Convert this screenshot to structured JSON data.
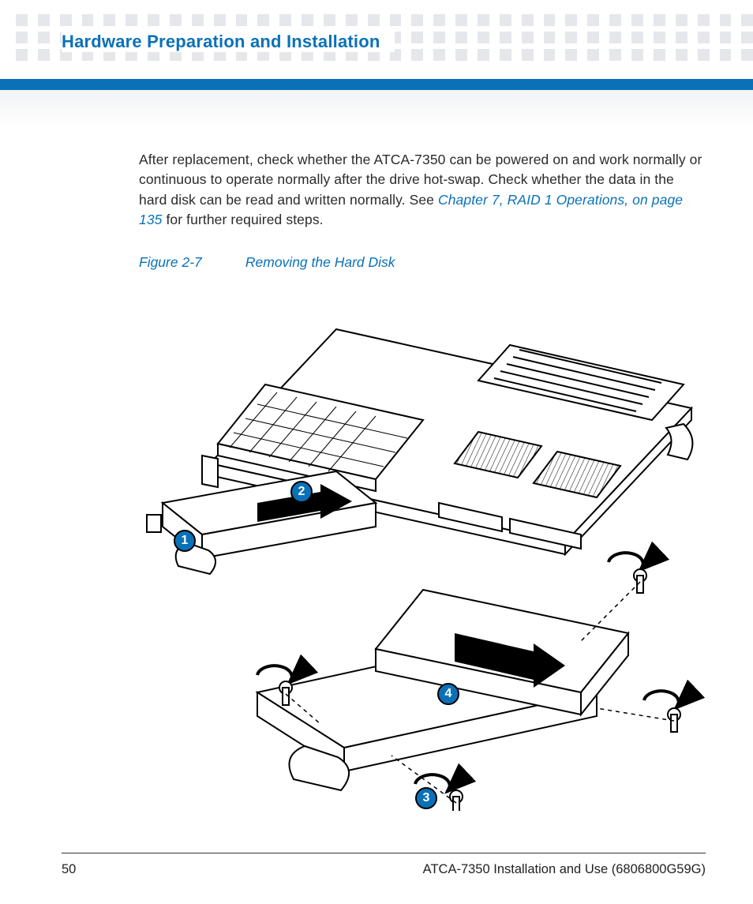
{
  "header": {
    "title": "Hardware Preparation and Installation"
  },
  "body": {
    "para_pre": "After replacement, check whether the ATCA-7350 can be powered on and work normally or continuous to operate normally after the drive hot-swap. Check whether the data in the hard disk can be read and written normally. See ",
    "link": "Chapter 7, RAID 1 Operations, on page 135",
    "para_post": " for further required steps."
  },
  "figure": {
    "number": "Figure 2-7",
    "title": "Removing the Hard Disk",
    "callouts": {
      "c1": "1",
      "c2": "2",
      "c3": "3",
      "c4": "4"
    }
  },
  "footer": {
    "page": "50",
    "doc": "ATCA-7350 Installation and Use (6806800G59G)"
  }
}
